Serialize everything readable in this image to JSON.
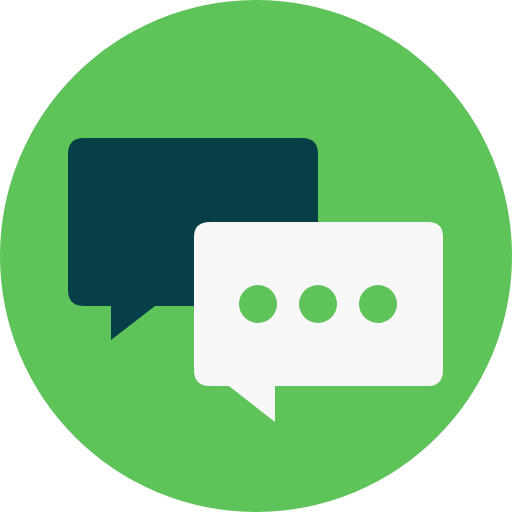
{
  "icon": {
    "name": "chat-bubbles-icon",
    "typing_dots": 3
  },
  "colors": {
    "background_circle": "#5EC45A",
    "back_bubble": "#073F48",
    "front_bubble": "#F7F7F7",
    "typing_dot": "#5EC45A"
  }
}
